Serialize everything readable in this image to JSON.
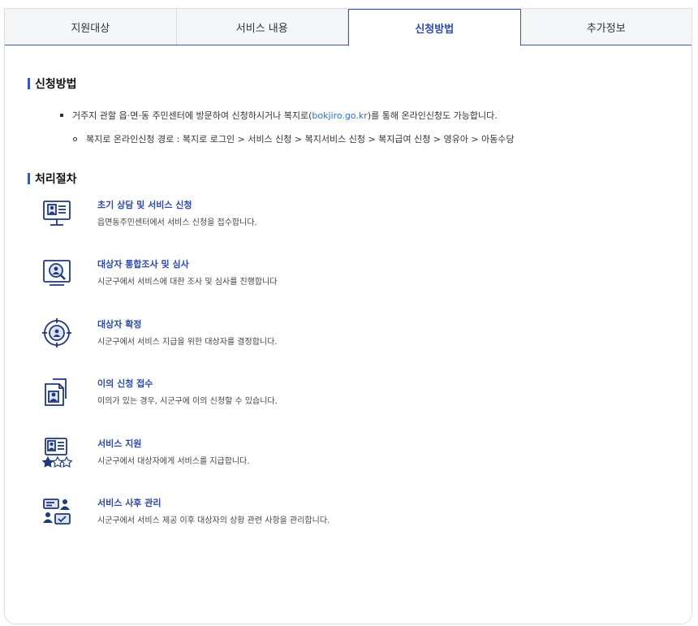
{
  "tabs": [
    {
      "label": "지원대상"
    },
    {
      "label": "서비스 내용"
    },
    {
      "label": "신청방법"
    },
    {
      "label": "추가정보"
    }
  ],
  "active_tab": "신청방법",
  "apply": {
    "title": "신청방법",
    "item1_prefix": "거주지 관할 읍·면·동 주민센터에 방문하여 신청하시거나 복지로(",
    "item1_link": "bokjiro.go.kr",
    "item1_suffix": ")를 통해 온라인신청도 가능합니다.",
    "item2": "복지로 온라인신청 경로 : 복지로 로그인 > 서비스 신청 > 복지서비스 신청 > 복지급여 신청 > 영유아 > 아동수당"
  },
  "process": {
    "title": "처리절차",
    "steps": [
      {
        "icon": "monitor-profile-icon",
        "title": "초기 상담 및 서비스 신청",
        "desc": "읍면동주민센터에서 서비스 신청을 접수합니다."
      },
      {
        "icon": "person-magnifier-icon",
        "title": "대상자 통합조사 및 심사",
        "desc": "시군구에서 서비스에 대한 조사 및 심사를 진행합니다"
      },
      {
        "icon": "person-target-icon",
        "title": "대상자 확정",
        "desc": "시군구에서 서비스 지급을 위한 대상자를 결정합니다."
      },
      {
        "icon": "document-person-icon",
        "title": "이의 신청 접수",
        "desc": "이의가 있는 경우, 시군구에 이의 신청할 수 있습니다."
      },
      {
        "icon": "profile-stars-icon",
        "title": "서비스 지원",
        "desc": "시군구에서 대상자에게 서비스를 지급합니다."
      },
      {
        "icon": "people-checklist-icon",
        "title": "서비스 사후 관리",
        "desc": "시군구에서 서비스 제공 이후 대상자의 상황 관련 사항을 관리합니다."
      }
    ]
  },
  "colors": {
    "accent": "#3a56b8",
    "icon": "#1f3a7a"
  }
}
